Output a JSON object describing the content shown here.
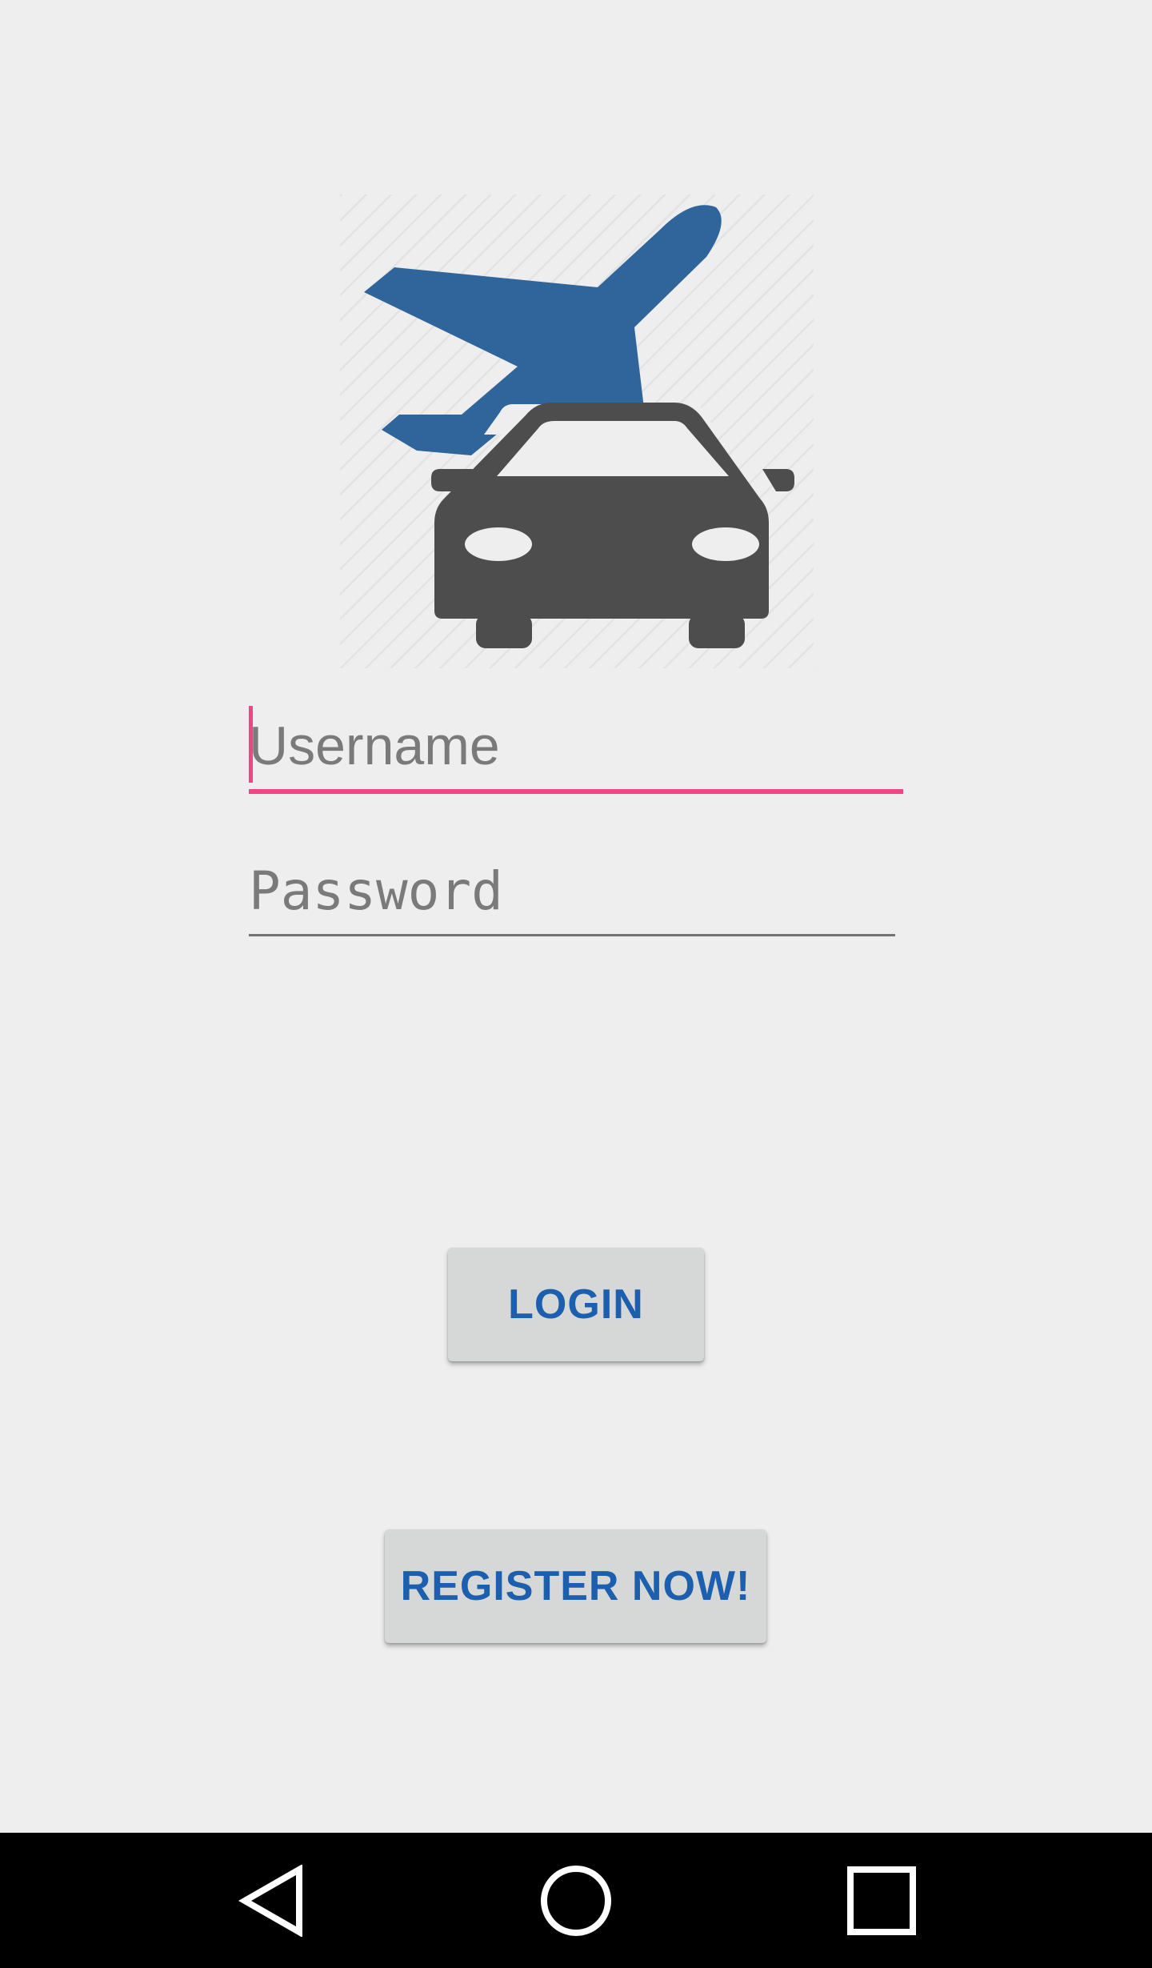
{
  "app": {
    "logo_icon": "plane-and-car-logo",
    "colors": {
      "background": "#eeeeee",
      "accent": "#f04583",
      "plane": "#2f659b",
      "car": "#4d4d4d",
      "button_background": "#d6d7d7",
      "button_text": "#1b5fae",
      "navbar": "#000000"
    }
  },
  "login_form": {
    "username_placeholder": "Username",
    "password_placeholder": "Password",
    "login_label": "LOGIN",
    "register_label": "REGISTER NOW!"
  },
  "system_nav": {
    "back_icon": "back-triangle-icon",
    "home_icon": "home-circle-icon",
    "recents_icon": "recents-square-icon"
  }
}
